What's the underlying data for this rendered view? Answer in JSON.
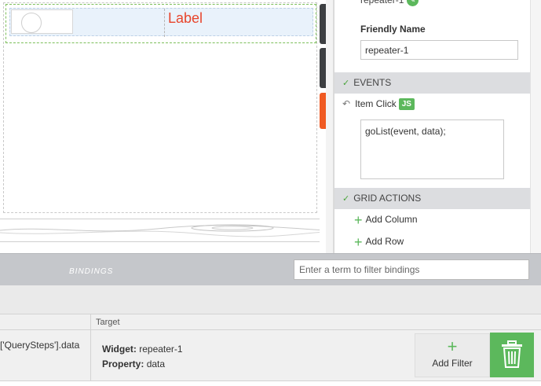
{
  "canvas": {
    "label_text": "Label"
  },
  "properties": {
    "partial_title": "repeater-1",
    "friendly_name_label": "Friendly Name",
    "friendly_name_value": "repeater-1",
    "events_header": "EVENTS",
    "event_name": "Item Click",
    "event_badge": "JS",
    "event_code": "goList(event, data);",
    "grid_actions_header": "GRID ACTIONS",
    "actions": [
      "Add Column",
      "Add Row"
    ]
  },
  "bindings": {
    "title": "BINDINGS",
    "filter_placeholder": "Enter a term to filter bindings",
    "columns": {
      "target": "Target"
    },
    "rows": [
      {
        "source": "['QuerySteps'].data",
        "widget_label": "Widget:",
        "widget_value": "repeater-1",
        "property_label": "Property:",
        "property_value": "data"
      }
    ],
    "add_filter_label": "Add Filter"
  },
  "colors": {
    "accent_green": "#5cb85c",
    "label_red": "#e8452c",
    "tab_orange": "#f05a22"
  },
  "icons": {
    "event_arrow": "arrow-left-icon",
    "chevron": "chevron-down-icon",
    "plus": "plus-icon",
    "trash": "trash-icon"
  }
}
